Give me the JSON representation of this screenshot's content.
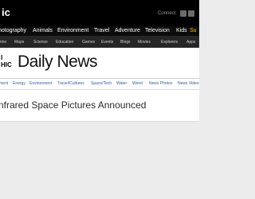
{
  "topbar": {
    "brand_fragment": "ic",
    "connect_label": "Connect:",
    "social": [
      "facebook-icon",
      "twitter-icon"
    ]
  },
  "main_nav": {
    "items": [
      "hotography",
      "Animals",
      "Environment",
      "Travel",
      "Adventure",
      "Television",
      "Kids",
      "Su"
    ],
    "accent_color": "#f5c518"
  },
  "sub_nav": {
    "items": [
      "zine",
      "Maps",
      "Science",
      "Education",
      "Games",
      "Events",
      "Blogs",
      "Movies",
      "Explorers",
      "Apps"
    ]
  },
  "masthead": {
    "brand_mark": "I\nHIC",
    "title": "Daily News"
  },
  "sections": {
    "items": [
      "ment",
      "Energy",
      "Environment",
      "Travel/Cultures",
      "Space/Tech",
      "Water",
      "Weird",
      "News Photos",
      "News Video"
    ],
    "link_color": "#2a5fa8"
  },
  "article": {
    "headline": "nfrared Space Pictures Announced"
  }
}
